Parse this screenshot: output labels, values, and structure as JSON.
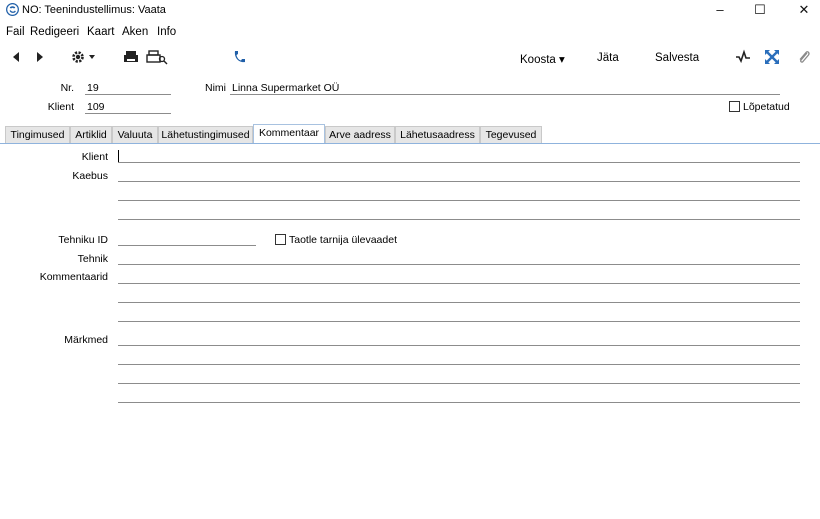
{
  "window": {
    "title": "NO: Teenindustellimus: Vaata",
    "minimize": "–",
    "maximize": "☐",
    "close": "✕"
  },
  "menu": [
    "Fail",
    "Redigeeri",
    "Kaart",
    "Aken",
    "Info"
  ],
  "toolbar": {
    "koosta": "Koosta ▾",
    "jata": "Jäta",
    "salvesta": "Salvesta"
  },
  "header": {
    "nr_label": "Nr.",
    "nr_value": "19",
    "nimi_label": "Nimi",
    "nimi_value": "Linna Supermarket OÜ",
    "klient_label": "Klient",
    "klient_value": "109",
    "lopetatud_label": "Lõpetatud"
  },
  "tabs": [
    {
      "label": "Tingimused"
    },
    {
      "label": "Artiklid"
    },
    {
      "label": "Valuuta"
    },
    {
      "label": "Lähetustingimused"
    },
    {
      "label": "Kommentaar"
    },
    {
      "label": "Arve aadress"
    },
    {
      "label": "Lähetusaadress"
    },
    {
      "label": "Tegevused"
    }
  ],
  "active_tab": "Kommentaar",
  "form": {
    "klient_label": "Klient",
    "kaebus_label": "Kaebus",
    "tehniku_id_label": "Tehniku ID",
    "taotle_label": "Taotle tarnija ülevaadet",
    "tehnik_label": "Tehnik",
    "kommentaarid_label": "Kommentaarid",
    "markmed_label": "Märkmed"
  },
  "colors": {
    "accent": "#2a6ebb",
    "tab_line": "#8fb3dd"
  }
}
